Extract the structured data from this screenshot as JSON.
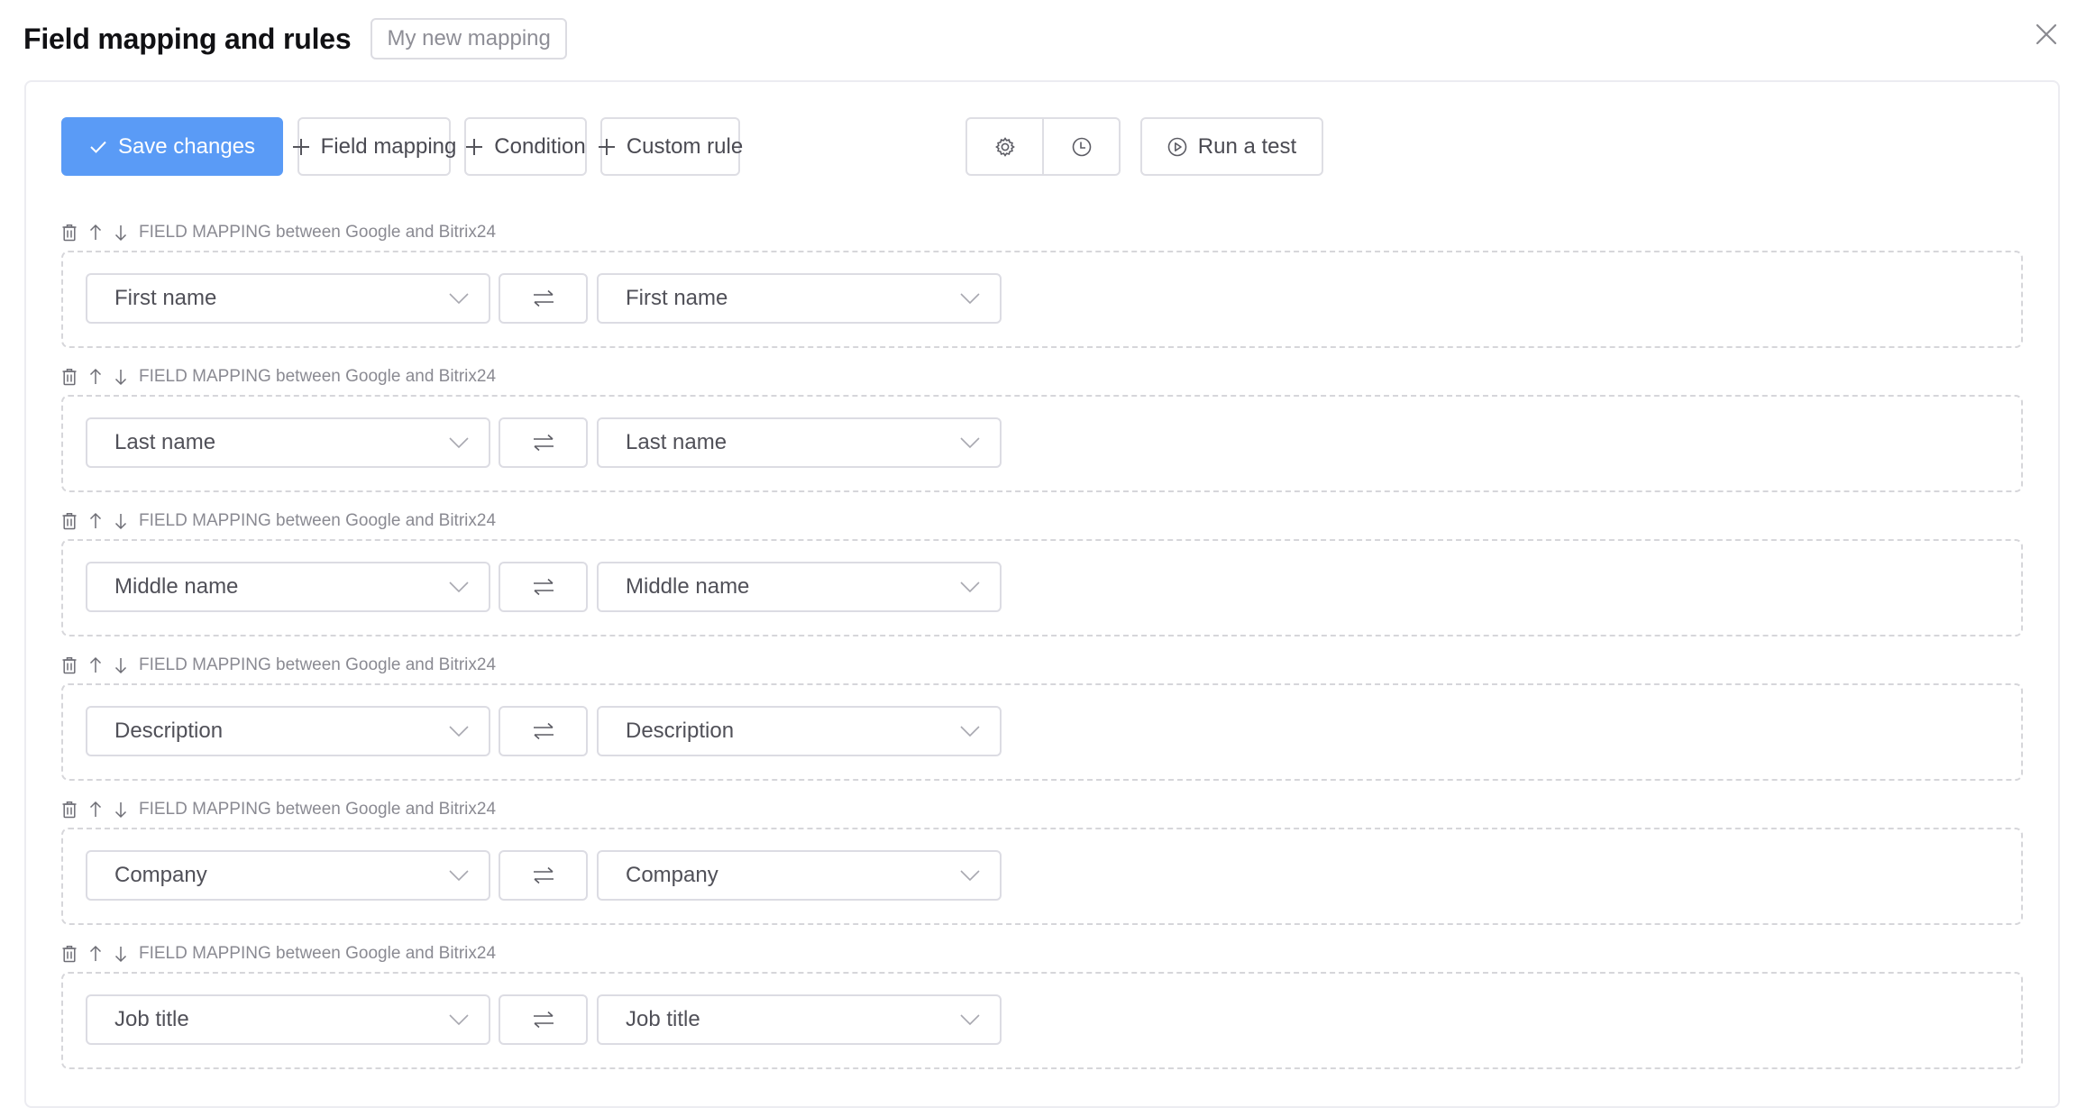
{
  "header": {
    "title": "Field mapping and rules",
    "mapping_name": "My new mapping"
  },
  "toolbar": {
    "save_label": "Save changes",
    "field_mapping_label": "Field mapping",
    "condition_label": "Condition",
    "custom_rule_label": "Custom rule",
    "run_test_label": "Run a test"
  },
  "icons": {
    "close": "close-icon",
    "save": "check-icon",
    "add": "plus-icon",
    "settings": "gear-icon",
    "history": "clock-icon",
    "run": "play-circle-icon",
    "delete": "trash-icon",
    "move_up": "arrow-up-icon",
    "move_down": "arrow-down-icon",
    "swap": "swap-arrows-icon",
    "dropdown": "chevron-down-icon"
  },
  "colors": {
    "primary": "#5a9bf6",
    "border": "#dedee4",
    "dashed_border": "#d6d6da",
    "muted_text": "#8a8a92"
  },
  "rules": [
    {
      "label": "FIELD MAPPING between Google and Bitrix24",
      "source": "First name",
      "target": "First name"
    },
    {
      "label": "FIELD MAPPING between Google and Bitrix24",
      "source": "Last name",
      "target": "Last name"
    },
    {
      "label": "FIELD MAPPING between Google and Bitrix24",
      "source": "Middle name",
      "target": "Middle name"
    },
    {
      "label": "FIELD MAPPING between Google and Bitrix24",
      "source": "Description",
      "target": "Description"
    },
    {
      "label": "FIELD MAPPING between Google and Bitrix24",
      "source": "Company",
      "target": "Company"
    },
    {
      "label": "FIELD MAPPING between Google and Bitrix24",
      "source": "Job title",
      "target": "Job title"
    }
  ]
}
